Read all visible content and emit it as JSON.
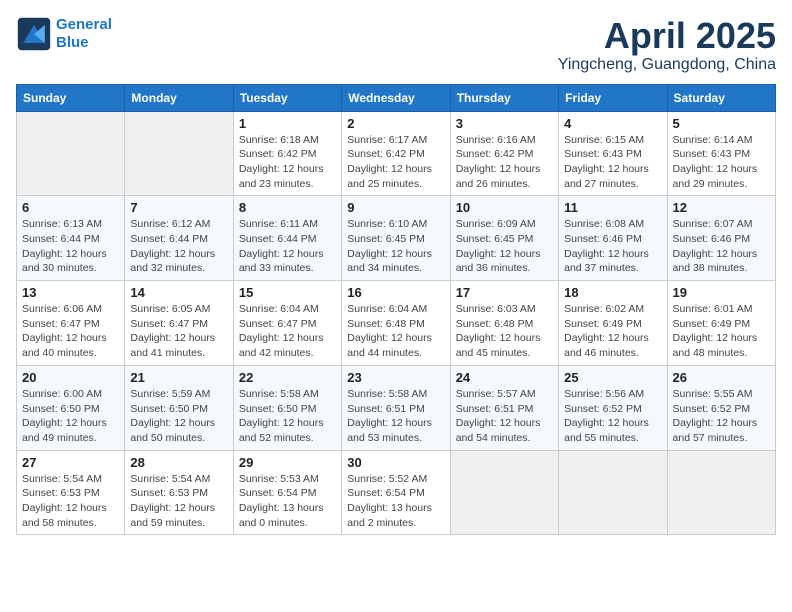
{
  "logo": {
    "line1": "General",
    "line2": "Blue"
  },
  "title": "April 2025",
  "location": "Yingcheng, Guangdong, China",
  "days_of_week": [
    "Sunday",
    "Monday",
    "Tuesday",
    "Wednesday",
    "Thursday",
    "Friday",
    "Saturday"
  ],
  "weeks": [
    [
      {
        "day": null
      },
      {
        "day": null
      },
      {
        "day": "1",
        "sunrise": "6:18 AM",
        "sunset": "6:42 PM",
        "daylight": "12 hours and 23 minutes."
      },
      {
        "day": "2",
        "sunrise": "6:17 AM",
        "sunset": "6:42 PM",
        "daylight": "12 hours and 25 minutes."
      },
      {
        "day": "3",
        "sunrise": "6:16 AM",
        "sunset": "6:42 PM",
        "daylight": "12 hours and 26 minutes."
      },
      {
        "day": "4",
        "sunrise": "6:15 AM",
        "sunset": "6:43 PM",
        "daylight": "12 hours and 27 minutes."
      },
      {
        "day": "5",
        "sunrise": "6:14 AM",
        "sunset": "6:43 PM",
        "daylight": "12 hours and 29 minutes."
      }
    ],
    [
      {
        "day": "6",
        "sunrise": "6:13 AM",
        "sunset": "6:44 PM",
        "daylight": "12 hours and 30 minutes."
      },
      {
        "day": "7",
        "sunrise": "6:12 AM",
        "sunset": "6:44 PM",
        "daylight": "12 hours and 32 minutes."
      },
      {
        "day": "8",
        "sunrise": "6:11 AM",
        "sunset": "6:44 PM",
        "daylight": "12 hours and 33 minutes."
      },
      {
        "day": "9",
        "sunrise": "6:10 AM",
        "sunset": "6:45 PM",
        "daylight": "12 hours and 34 minutes."
      },
      {
        "day": "10",
        "sunrise": "6:09 AM",
        "sunset": "6:45 PM",
        "daylight": "12 hours and 36 minutes."
      },
      {
        "day": "11",
        "sunrise": "6:08 AM",
        "sunset": "6:46 PM",
        "daylight": "12 hours and 37 minutes."
      },
      {
        "day": "12",
        "sunrise": "6:07 AM",
        "sunset": "6:46 PM",
        "daylight": "12 hours and 38 minutes."
      }
    ],
    [
      {
        "day": "13",
        "sunrise": "6:06 AM",
        "sunset": "6:47 PM",
        "daylight": "12 hours and 40 minutes."
      },
      {
        "day": "14",
        "sunrise": "6:05 AM",
        "sunset": "6:47 PM",
        "daylight": "12 hours and 41 minutes."
      },
      {
        "day": "15",
        "sunrise": "6:04 AM",
        "sunset": "6:47 PM",
        "daylight": "12 hours and 42 minutes."
      },
      {
        "day": "16",
        "sunrise": "6:04 AM",
        "sunset": "6:48 PM",
        "daylight": "12 hours and 44 minutes."
      },
      {
        "day": "17",
        "sunrise": "6:03 AM",
        "sunset": "6:48 PM",
        "daylight": "12 hours and 45 minutes."
      },
      {
        "day": "18",
        "sunrise": "6:02 AM",
        "sunset": "6:49 PM",
        "daylight": "12 hours and 46 minutes."
      },
      {
        "day": "19",
        "sunrise": "6:01 AM",
        "sunset": "6:49 PM",
        "daylight": "12 hours and 48 minutes."
      }
    ],
    [
      {
        "day": "20",
        "sunrise": "6:00 AM",
        "sunset": "6:50 PM",
        "daylight": "12 hours and 49 minutes."
      },
      {
        "day": "21",
        "sunrise": "5:59 AM",
        "sunset": "6:50 PM",
        "daylight": "12 hours and 50 minutes."
      },
      {
        "day": "22",
        "sunrise": "5:58 AM",
        "sunset": "6:50 PM",
        "daylight": "12 hours and 52 minutes."
      },
      {
        "day": "23",
        "sunrise": "5:58 AM",
        "sunset": "6:51 PM",
        "daylight": "12 hours and 53 minutes."
      },
      {
        "day": "24",
        "sunrise": "5:57 AM",
        "sunset": "6:51 PM",
        "daylight": "12 hours and 54 minutes."
      },
      {
        "day": "25",
        "sunrise": "5:56 AM",
        "sunset": "6:52 PM",
        "daylight": "12 hours and 55 minutes."
      },
      {
        "day": "26",
        "sunrise": "5:55 AM",
        "sunset": "6:52 PM",
        "daylight": "12 hours and 57 minutes."
      }
    ],
    [
      {
        "day": "27",
        "sunrise": "5:54 AM",
        "sunset": "6:53 PM",
        "daylight": "12 hours and 58 minutes."
      },
      {
        "day": "28",
        "sunrise": "5:54 AM",
        "sunset": "6:53 PM",
        "daylight": "12 hours and 59 minutes."
      },
      {
        "day": "29",
        "sunrise": "5:53 AM",
        "sunset": "6:54 PM",
        "daylight": "13 hours and 0 minutes."
      },
      {
        "day": "30",
        "sunrise": "5:52 AM",
        "sunset": "6:54 PM",
        "daylight": "13 hours and 2 minutes."
      },
      {
        "day": null
      },
      {
        "day": null
      },
      {
        "day": null
      }
    ]
  ]
}
